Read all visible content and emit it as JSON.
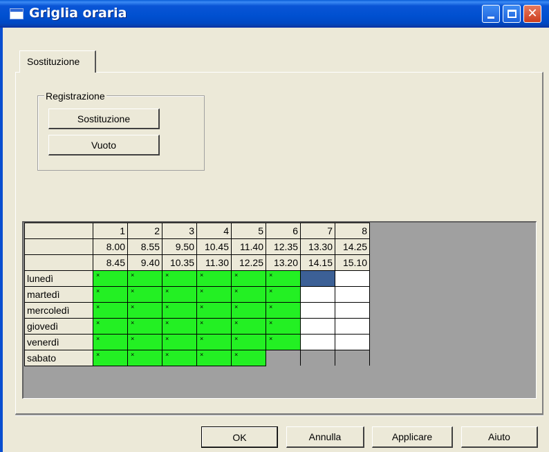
{
  "window": {
    "title": "Griglia oraria",
    "colors": {
      "titlebar": "#0050d0",
      "active": "#23f023",
      "selected": "#3c6096"
    },
    "icons": [
      "window-icon",
      "minimize-icon",
      "maximize-icon",
      "close-icon"
    ]
  },
  "tabs": [
    {
      "label": "Sostituzione",
      "selected": true
    }
  ],
  "registrazione": {
    "label": "Registrazione",
    "buttons": [
      "Sostituzione",
      "Vuoto"
    ]
  },
  "grid": {
    "periods": [
      "1",
      "2",
      "3",
      "4",
      "5",
      "6",
      "7",
      "8"
    ],
    "start_times": [
      "8.00",
      "8.55",
      "9.50",
      "10.45",
      "11.40",
      "12.35",
      "13.30",
      "14.25"
    ],
    "end_times": [
      "8.45",
      "9.40",
      "10.35",
      "11.30",
      "12.25",
      "13.20",
      "14.15",
      "15.10"
    ],
    "days": [
      {
        "name": "lunedì",
        "cells": [
          "x",
          "x",
          "x",
          "x",
          "x",
          "x",
          "selected",
          "empty"
        ]
      },
      {
        "name": "martedì",
        "cells": [
          "x",
          "x",
          "x",
          "x",
          "x",
          "x",
          "empty",
          "empty"
        ]
      },
      {
        "name": "mercoledì",
        "cells": [
          "x",
          "x",
          "x",
          "x",
          "x",
          "x",
          "empty",
          "empty"
        ]
      },
      {
        "name": "giovedì",
        "cells": [
          "x",
          "x",
          "x",
          "x",
          "x",
          "x",
          "empty",
          "empty"
        ]
      },
      {
        "name": "venerdì",
        "cells": [
          "x",
          "x",
          "x",
          "x",
          "x",
          "x",
          "empty",
          "empty"
        ]
      },
      {
        "name": "sabato",
        "cells": [
          "x",
          "x",
          "x",
          "x",
          "x",
          "none",
          "none",
          "none"
        ]
      }
    ],
    "mark": "×"
  },
  "footer": {
    "ok": "OK",
    "cancel": "Annulla",
    "apply": "Applicare",
    "help": "Aiuto"
  }
}
